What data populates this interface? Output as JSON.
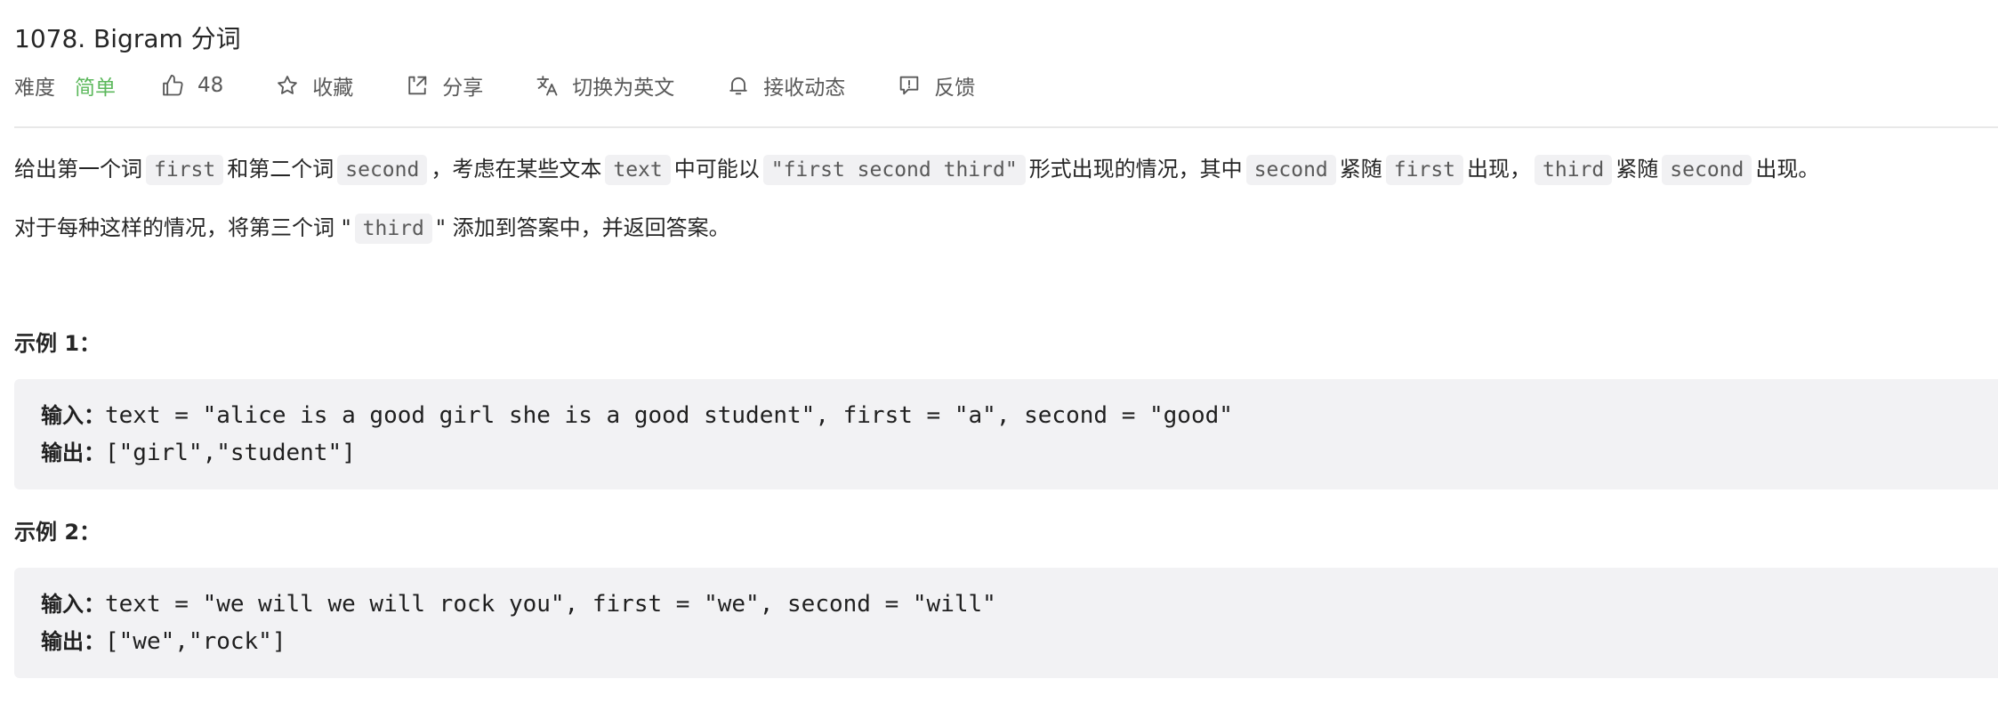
{
  "problem": {
    "title": "1078. Bigram 分词"
  },
  "meta": {
    "difficulty_label": "难度",
    "difficulty_value": "简单",
    "like_count": "48",
    "favorite_label": "收藏",
    "share_label": "分享",
    "switch_lang_label": "切换为英文",
    "subscribe_label": "接收动态",
    "feedback_label": "反馈"
  },
  "description": {
    "p1": {
      "t1": "给出第一个词",
      "c1": "first",
      "t2": "和第二个词",
      "c2": "second",
      "t3": "，考虑在某些文本",
      "c3": "text",
      "t4": "中可能以",
      "c4": "\"first second third\"",
      "t5": "形式出现的情况，其中",
      "c5": "second",
      "t6": "紧随",
      "c6": "first",
      "t7": "出现，",
      "c7": "third",
      "t8": "紧随",
      "c8": "second",
      "t9": "出现。"
    },
    "p2": {
      "t1": "对于每种这样的情况，将第三个词 \"",
      "c1": "third",
      "t2": "\" 添加到答案中，并返回答案。"
    }
  },
  "examples": [
    {
      "heading": "示例 1：",
      "input_label": "输入：",
      "input_value": "text = \"alice is a good girl she is a good student\", first = \"a\", second = \"good\"",
      "output_label": "输出：",
      "output_value": "[\"girl\",\"student\"]"
    },
    {
      "heading": "示例 2：",
      "input_label": "输入：",
      "input_value": "text = \"we will we will rock you\", first = \"we\", second = \"will\"",
      "output_label": "输出：",
      "output_value": "[\"we\",\"rock\"]"
    }
  ],
  "icons": {
    "like": "thumbs-up-icon",
    "favorite": "star-icon",
    "share": "share-icon",
    "switch_lang": "translate-icon",
    "subscribe": "bell-icon",
    "feedback": "feedback-icon"
  },
  "colors": {
    "difficulty_easy": "#5cb85c",
    "code_bg": "#f1f1f3",
    "block_bg": "#f2f2f4"
  }
}
